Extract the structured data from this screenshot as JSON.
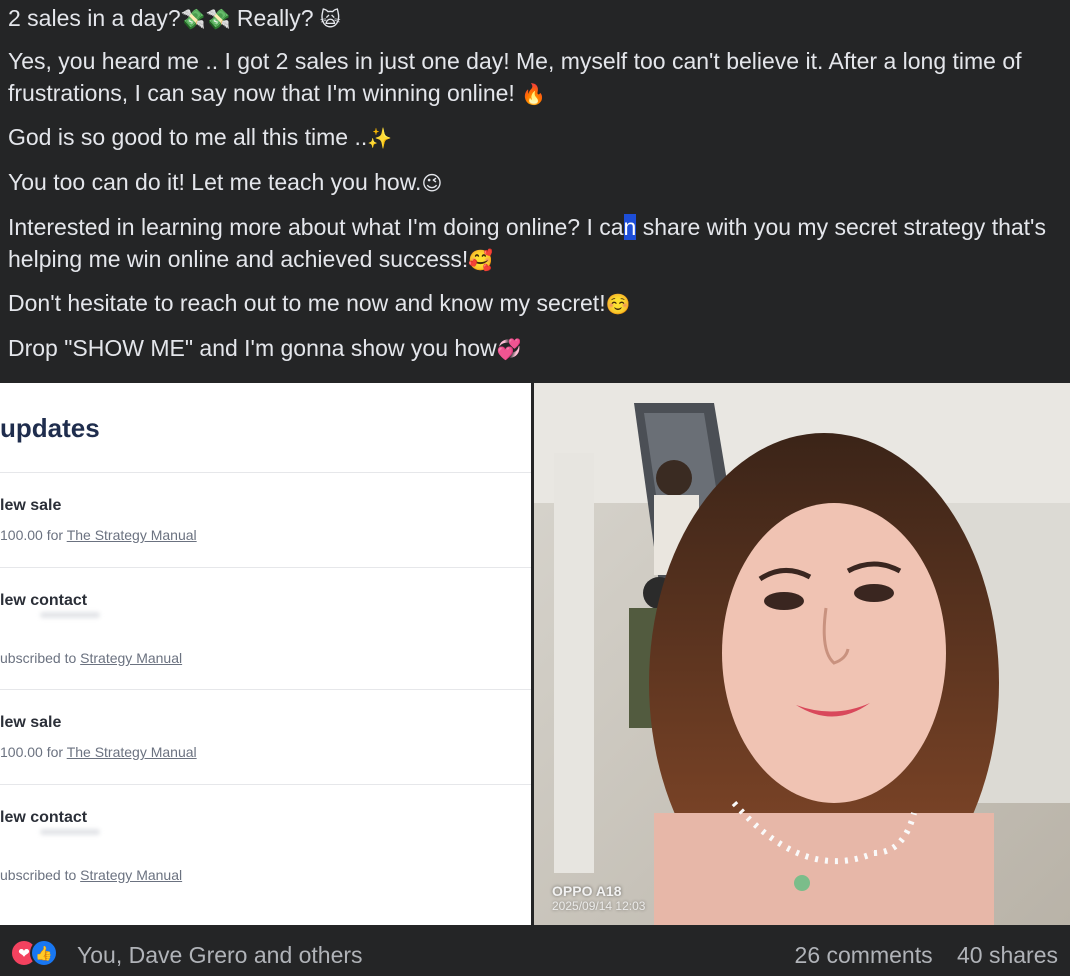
{
  "post": {
    "lines": [
      {
        "text": "2 sales in a day?",
        "emoji": "💸💸",
        "after": " Really? ",
        "emoji2": "🙀"
      },
      {
        "text": "Yes, you heard me .. I got 2 sales in just one day! Me, myself too can't believe it. After a long time of frustrations, I can say now that I'm winning online! ",
        "emoji": "🔥"
      },
      {
        "text": "God is so good to me all this time ..",
        "emoji": "✨"
      },
      {
        "text": "You too can do it! Let me teach you how.",
        "emoji": "😉"
      },
      {
        "text_before": "Interested in learning more about what I'm doing online? I ca",
        "selected": "n",
        "text_after": " share with you my secret strategy that's helping me win online and achieved success!",
        "emoji": "🥰"
      },
      {
        "text": "Don't hesitate to reach out to me now and know my secret!",
        "emoji": "☺️"
      },
      {
        "text": "Drop \"SHOW ME\" and I'm gonna show you how",
        "emoji": "💞"
      }
    ]
  },
  "screenshot": {
    "title": "updates",
    "items": [
      {
        "title": "lew sale",
        "sub_prefix": "100.00 for ",
        "link": "The Strategy Manual"
      },
      {
        "title": "lew contact",
        "sub_prefix": "ubscribed to ",
        "link": "Strategy Manual"
      },
      {
        "title": "lew sale",
        "sub_prefix": "100.00 for ",
        "link": "The Strategy Manual"
      },
      {
        "title": "lew contact",
        "sub_prefix": "ubscribed to ",
        "link": "Strategy Manual"
      }
    ]
  },
  "photo": {
    "watermark_model": "OPPO A18",
    "watermark_date": "2025/09/14 12:03"
  },
  "footer": {
    "reaction_icons": [
      "heart-reaction-icon",
      "like-reaction-icon"
    ],
    "reactors": "You, Dave Grero and others",
    "comments": "26 comments",
    "shares": "40 shares"
  }
}
